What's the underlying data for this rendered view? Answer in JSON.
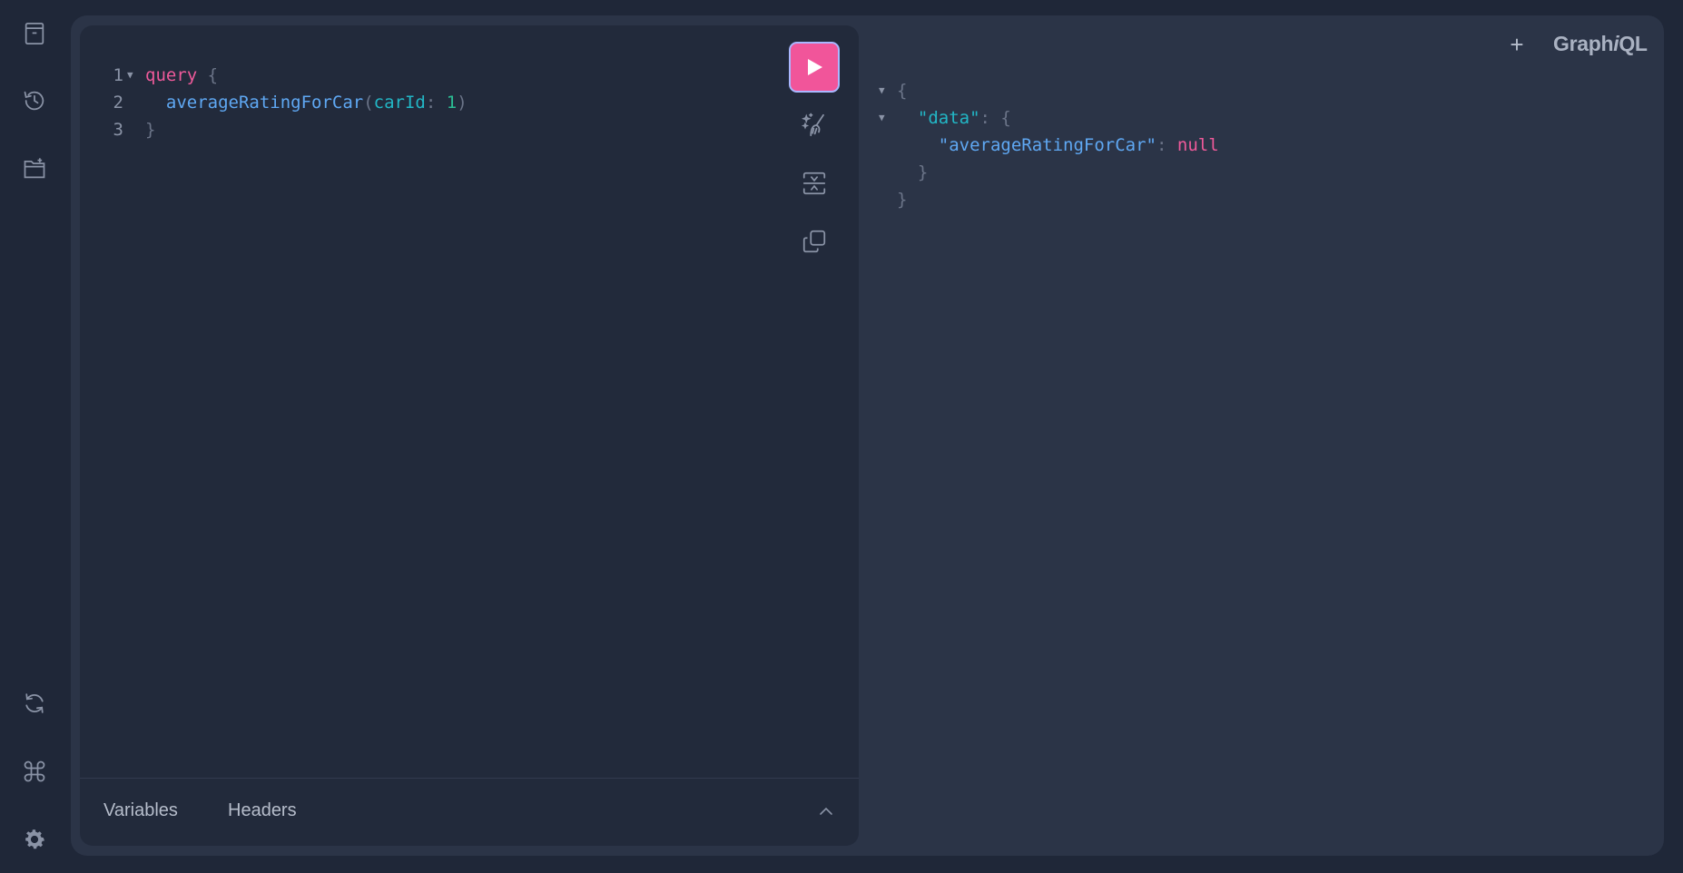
{
  "app": {
    "logo_prefix": "Graph",
    "logo_italic": "i",
    "logo_suffix": "QL",
    "new_tab_label": "+"
  },
  "sidebar": {
    "top_items": [
      {
        "icon": "docs-icon"
      },
      {
        "icon": "history-icon"
      },
      {
        "icon": "folder-plus-icon"
      }
    ],
    "bottom_items": [
      {
        "icon": "refresh-icon"
      },
      {
        "icon": "command-icon"
      },
      {
        "icon": "settings-gear-icon"
      }
    ]
  },
  "editor": {
    "lines": [
      {
        "number": "1",
        "foldable": true,
        "tokens": [
          {
            "t": "query",
            "c": "kw"
          },
          {
            "t": " {",
            "c": "punc"
          }
        ]
      },
      {
        "number": "2",
        "foldable": false,
        "tokens": [
          {
            "t": "  averageRatingForCar",
            "c": "field"
          },
          {
            "t": "(",
            "c": "punc"
          },
          {
            "t": "carId",
            "c": "arg"
          },
          {
            "t": ": ",
            "c": "punc"
          },
          {
            "t": "1",
            "c": "num"
          },
          {
            "t": ")",
            "c": "punc"
          }
        ]
      },
      {
        "number": "3",
        "foldable": false,
        "tokens": [
          {
            "t": "}",
            "c": "punc"
          }
        ]
      }
    ],
    "toolbar": [
      "run-icon",
      "prettify-icon",
      "merge-fragments-icon",
      "copy-icon"
    ],
    "footer_tabs": {
      "variables": "Variables",
      "headers": "Headers"
    }
  },
  "result": {
    "lines": [
      {
        "foldable": true,
        "tokens": [
          {
            "t": "{",
            "c": "punc"
          }
        ]
      },
      {
        "foldable": true,
        "tokens": [
          {
            "t": "  \"data\"",
            "c": "str"
          },
          {
            "t": ": {",
            "c": "punc"
          }
        ]
      },
      {
        "foldable": false,
        "tokens": [
          {
            "t": "    \"averageRatingForCar\"",
            "c": "key"
          },
          {
            "t": ": ",
            "c": "punc"
          },
          {
            "t": "null",
            "c": "nul"
          }
        ]
      },
      {
        "foldable": false,
        "tokens": [
          {
            "t": "  }",
            "c": "punc"
          }
        ]
      },
      {
        "foldable": false,
        "tokens": [
          {
            "t": "}",
            "c": "punc"
          }
        ]
      }
    ]
  },
  "colors": {
    "run_button": "#f1559a",
    "background": "#1f2738",
    "surface": "#2b3447",
    "editor": "#222a3b"
  }
}
